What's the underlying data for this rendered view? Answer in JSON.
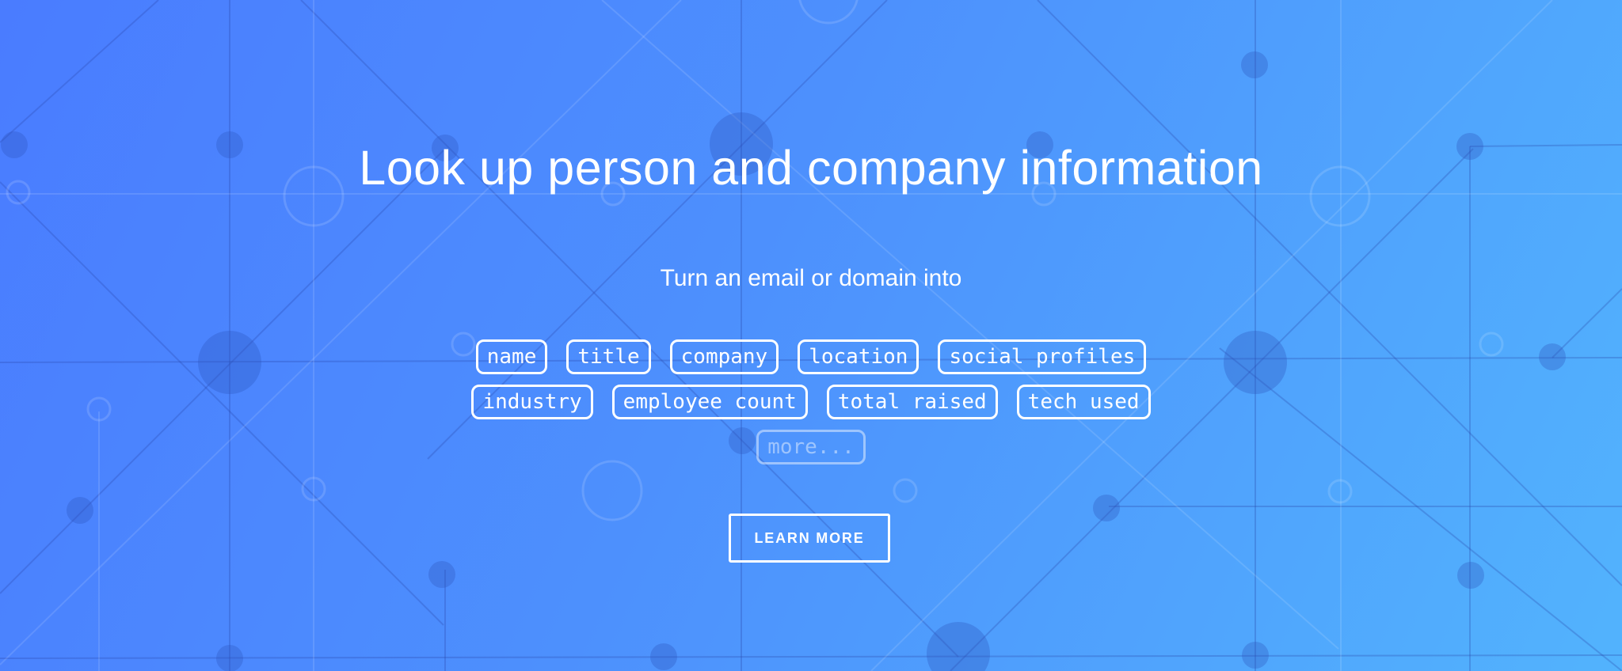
{
  "hero": {
    "headline": "Look up person and company information",
    "subtitle": "Turn an email or domain into",
    "tags_row1": [
      "name",
      "title",
      "company",
      "location",
      "social profiles"
    ],
    "tags_row2": [
      "industry",
      "employee count",
      "total raised",
      "tech used"
    ],
    "more_label": "more...",
    "cta_label": "LEARN MORE"
  },
  "colors": {
    "gradient_start": "#4a7cff",
    "gradient_end": "#52b3fd",
    "text": "#ffffff"
  }
}
